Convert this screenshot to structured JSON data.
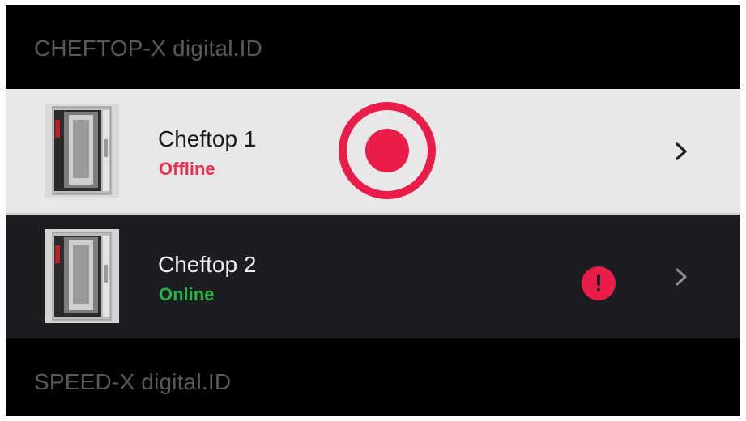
{
  "sections": [
    {
      "title": "CHEFTOP-X digital.ID"
    },
    {
      "title": "SPEED-X digital.ID"
    }
  ],
  "devices": [
    {
      "name": "Cheftop 1",
      "status": "Offline",
      "status_color": "#e8304f",
      "selected": true,
      "alert": false
    },
    {
      "name": "Cheftop 2",
      "status": "Online",
      "status_color": "#27b34a",
      "selected": false,
      "alert": true
    }
  ],
  "colors": {
    "accent": "#ea1d4a",
    "selected_row_bg": "#e8e8e8",
    "row_bg": "#1c1d21",
    "header_bg": "#000000"
  },
  "icons": {
    "row_chevron": "chevron-right-icon",
    "alert": "exclamation-alert-icon",
    "tap": "tap-indicator"
  }
}
